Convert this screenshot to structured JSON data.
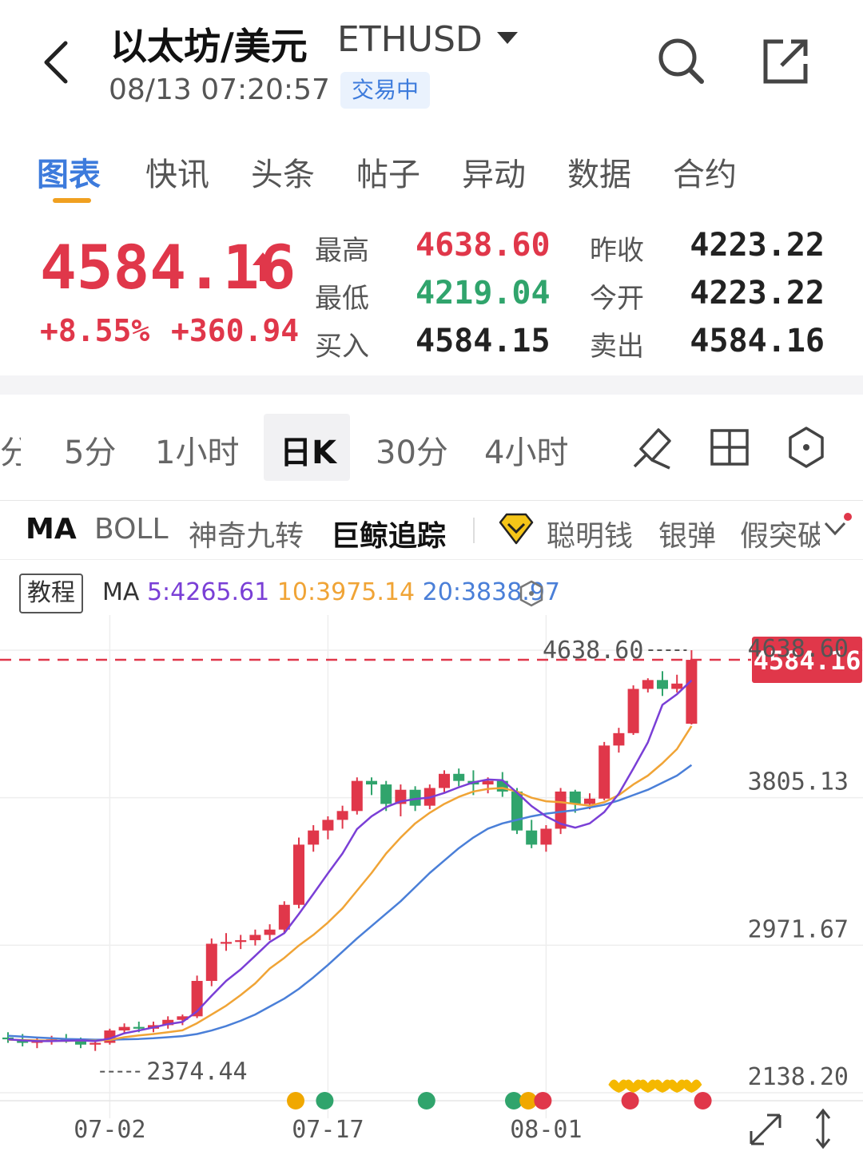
{
  "header": {
    "title": "以太坊/美元",
    "symbol": "ETHUSD",
    "timestamp": "08/13 07:20:57",
    "status": "交易中"
  },
  "tabs": [
    {
      "label": "图表",
      "active": true
    },
    {
      "label": "快讯"
    },
    {
      "label": "头条"
    },
    {
      "label": "帖子"
    },
    {
      "label": "异动"
    },
    {
      "label": "数据"
    },
    {
      "label": "合约"
    }
  ],
  "quote": {
    "price": "4584.16",
    "change_pct": "+8.55%",
    "change_abs": "+360.94",
    "high_label": "最高",
    "high": "4638.60",
    "low_label": "最低",
    "low": "4219.04",
    "bid_label": "买入",
    "bid": "4584.15",
    "prev_close_label": "昨收",
    "prev_close": "4223.22",
    "open_label": "今开",
    "open": "4223.22",
    "ask_label": "卖出",
    "ask": "4584.16"
  },
  "periods": {
    "partial": "分",
    "items": [
      "5分",
      "1小时",
      "日K",
      "30分",
      "4小时"
    ],
    "active": "日K"
  },
  "indicators": {
    "items": [
      "MA",
      "BOLL",
      "神奇九转",
      "巨鲸追踪",
      "聪明钱",
      "银弹",
      "假突破"
    ],
    "selected": [
      "MA",
      "巨鲸追踪"
    ]
  },
  "ma_legend": {
    "tutorial": "教程",
    "title": "MA",
    "ma5": "5:4265.61",
    "ma10": "10:3975.14",
    "ma20": "20:3838.97"
  },
  "colors": {
    "up": "#e0374a",
    "down": "#30a46c",
    "ma5": "#7a3fd6",
    "ma10": "#f0a436",
    "ma20": "#4a7fd8",
    "accent": "#3d7bdc"
  },
  "chart_data": {
    "type": "candlestick",
    "y_axis_labels": [
      "4638.60",
      "3805.13",
      "2971.67",
      "2138.20"
    ],
    "x_axis_labels": [
      "07-02",
      "07-17",
      "08-01"
    ],
    "last_price_label": "4584.16",
    "high_marker": "4638.60",
    "low_marker": "2374.44",
    "ylim": [
      2138.2,
      4638.6
    ],
    "candles": [
      [
        2450,
        2480,
        2420,
        2440
      ],
      [
        2440,
        2470,
        2400,
        2420
      ],
      [
        2420,
        2450,
        2390,
        2430
      ],
      [
        2430,
        2460,
        2410,
        2440
      ],
      [
        2440,
        2470,
        2420,
        2430
      ],
      [
        2430,
        2450,
        2390,
        2410
      ],
      [
        2410,
        2440,
        2374.44,
        2420
      ],
      [
        2420,
        2500,
        2410,
        2490
      ],
      [
        2490,
        2530,
        2470,
        2510
      ],
      [
        2510,
        2540,
        2480,
        2500
      ],
      [
        2500,
        2540,
        2480,
        2520
      ],
      [
        2520,
        2570,
        2500,
        2550
      ],
      [
        2550,
        2580,
        2520,
        2570
      ],
      [
        2570,
        2800,
        2560,
        2770
      ],
      [
        2770,
        3010,
        2740,
        2980
      ],
      [
        2980,
        3040,
        2940,
        2990
      ],
      [
        2990,
        3030,
        2950,
        3000
      ],
      [
        3000,
        3060,
        2970,
        3030
      ],
      [
        3030,
        3090,
        3000,
        3060
      ],
      [
        3060,
        3220,
        3040,
        3200
      ],
      [
        3200,
        3580,
        3180,
        3540
      ],
      [
        3540,
        3650,
        3500,
        3620
      ],
      [
        3620,
        3700,
        3570,
        3680
      ],
      [
        3680,
        3760,
        3630,
        3730
      ],
      [
        3730,
        3920,
        3710,
        3900
      ],
      [
        3900,
        3920,
        3820,
        3880
      ],
      [
        3880,
        3900,
        3730,
        3770
      ],
      [
        3770,
        3880,
        3700,
        3850
      ],
      [
        3850,
        3870,
        3730,
        3760
      ],
      [
        3760,
        3880,
        3740,
        3860
      ],
      [
        3860,
        3960,
        3830,
        3940
      ],
      [
        3940,
        3970,
        3870,
        3900
      ],
      [
        3900,
        3960,
        3820,
        3880
      ],
      [
        3880,
        3920,
        3830,
        3900
      ],
      [
        3900,
        3950,
        3810,
        3840
      ],
      [
        3840,
        3860,
        3600,
        3620
      ],
      [
        3620,
        3680,
        3520,
        3540
      ],
      [
        3540,
        3650,
        3500,
        3630
      ],
      [
        3630,
        3860,
        3600,
        3840
      ],
      [
        3840,
        3850,
        3720,
        3770
      ],
      [
        3770,
        3830,
        3740,
        3800
      ],
      [
        3800,
        4120,
        3790,
        4100
      ],
      [
        4100,
        4200,
        4060,
        4170
      ],
      [
        4170,
        4440,
        4160,
        4420
      ],
      [
        4420,
        4480,
        4400,
        4470
      ],
      [
        4470,
        4520,
        4380,
        4420
      ],
      [
        4420,
        4500,
        4400,
        4450
      ],
      [
        4223.22,
        4638.6,
        4219.04,
        4584.16
      ]
    ],
    "ma5_series": [
      2440,
      2434,
      2430,
      2430,
      2432,
      2434,
      2430,
      2444,
      2474,
      2490,
      2507,
      2526,
      2538,
      2598,
      2686,
      2770,
      2835,
      2912,
      2990,
      3040,
      3148,
      3262,
      3378,
      3490,
      3628,
      3700,
      3752,
      3784,
      3798,
      3806,
      3832,
      3864,
      3892,
      3908,
      3904,
      3834,
      3758,
      3700,
      3658,
      3636,
      3660,
      3724,
      3828,
      3970,
      4118,
      4330,
      4390,
      4468
    ],
    "ma10_series": [
      2438,
      2436,
      2434,
      2432,
      2431,
      2433,
      2432,
      2437,
      2452,
      2462,
      2470,
      2480,
      2491,
      2531,
      2580,
      2630,
      2690,
      2756,
      2840,
      2900,
      2970,
      3030,
      3100,
      3180,
      3280,
      3380,
      3490,
      3580,
      3660,
      3720,
      3770,
      3810,
      3840,
      3855,
      3860,
      3840,
      3805,
      3785,
      3780,
      3770,
      3760,
      3780,
      3820,
      3880,
      3930,
      4000,
      4080,
      4210
    ],
    "ma20_series": [
      2460,
      2455,
      2450,
      2446,
      2442,
      2440,
      2438,
      2438,
      2440,
      2442,
      2446,
      2452,
      2458,
      2470,
      2490,
      2515,
      2545,
      2580,
      2625,
      2670,
      2725,
      2790,
      2860,
      2935,
      3010,
      3080,
      3150,
      3220,
      3300,
      3380,
      3450,
      3520,
      3580,
      3630,
      3660,
      3680,
      3700,
      3715,
      3725,
      3735,
      3750,
      3765,
      3790,
      3820,
      3850,
      3890,
      3930,
      3990
    ]
  }
}
